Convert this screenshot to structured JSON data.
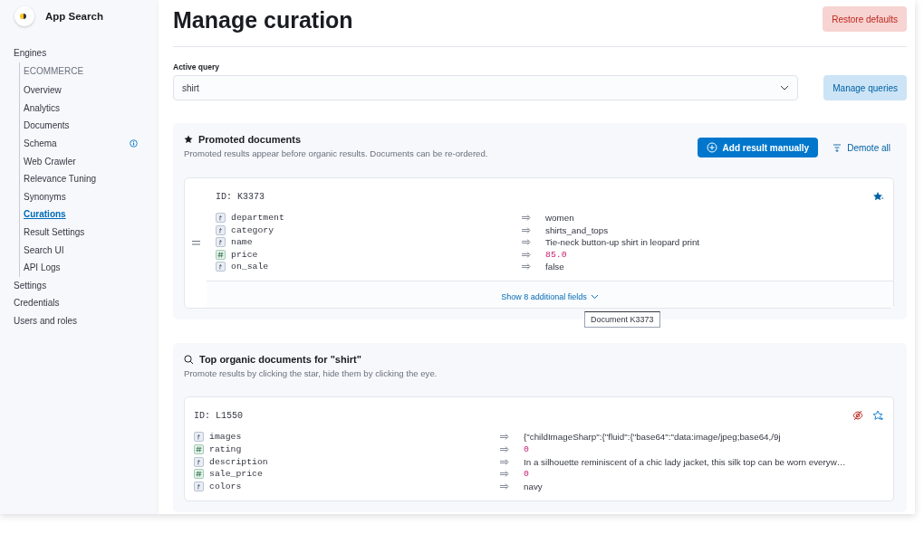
{
  "app": {
    "title": "App Search"
  },
  "sidebar": {
    "items": [
      {
        "label": "Engines",
        "children": [
          {
            "label": "ECOMMERCE",
            "kind": "heading",
            "selected": false,
            "notice": false
          },
          {
            "label": "Overview",
            "kind": "link",
            "selected": false,
            "notice": false
          },
          {
            "label": "Analytics",
            "kind": "link",
            "selected": false,
            "notice": false
          },
          {
            "label": "Documents",
            "kind": "link",
            "selected": false,
            "notice": false
          },
          {
            "label": "Schema",
            "kind": "link",
            "selected": false,
            "notice": true
          },
          {
            "label": "Web Crawler",
            "kind": "link",
            "selected": false,
            "notice": false
          },
          {
            "label": "Relevance Tuning",
            "kind": "link",
            "selected": false,
            "notice": false
          },
          {
            "label": "Synonyms",
            "kind": "link",
            "selected": false,
            "notice": false
          },
          {
            "label": "Curations",
            "kind": "link",
            "selected": true,
            "notice": false
          },
          {
            "label": "Result Settings",
            "kind": "link",
            "selected": false,
            "notice": false
          },
          {
            "label": "Search UI",
            "kind": "link",
            "selected": false,
            "notice": false
          },
          {
            "label": "API Logs",
            "kind": "link",
            "selected": false,
            "notice": false
          }
        ]
      },
      {
        "label": "Settings"
      },
      {
        "label": "Credentials"
      },
      {
        "label": "Users and roles"
      }
    ]
  },
  "page": {
    "title": "Manage curation",
    "restore_button": "Restore defaults"
  },
  "query": {
    "label": "Active query",
    "value": "shirt",
    "manage_button": "Manage queries"
  },
  "promoted": {
    "title": "Promoted documents",
    "description": "Promoted results appear before organic results. Documents can be re-ordered.",
    "add_button": "Add result manually",
    "demote_button": "Demote all",
    "documents": [
      {
        "id": "ID: K3373",
        "promoted": true,
        "fields": [
          {
            "kind": "text",
            "name": "department",
            "value": "women"
          },
          {
            "kind": "text",
            "name": "category",
            "value": "shirts_and_tops"
          },
          {
            "kind": "text",
            "name": "name",
            "value": "Tie-neck button-up shirt in leopard print"
          },
          {
            "kind": "number",
            "name": "price",
            "value": "85.0"
          },
          {
            "kind": "text",
            "name": "on_sale",
            "value": "false"
          }
        ],
        "more": "Show 8 additional fields",
        "tooltip": "Document K3373"
      }
    ]
  },
  "organic": {
    "title": "Top organic documents for \"shirt\"",
    "description": "Promote results by clicking the star, hide them by clicking the eye.",
    "documents": [
      {
        "id": "ID: L1550",
        "promoted": false,
        "fields": [
          {
            "kind": "text",
            "name": "images",
            "value": "{\"childImageSharp\":{\"fluid\":{\"base64\":\"data:image/jpeg;base64,/9j"
          },
          {
            "kind": "number",
            "name": "rating",
            "value": "0"
          },
          {
            "kind": "text",
            "name": "description",
            "value": "In a silhouette reminiscent of a chic lady jacket, this silk top can be worn everyw…"
          },
          {
            "kind": "number",
            "name": "sale_price",
            "value": "0"
          },
          {
            "kind": "text",
            "name": "colors",
            "value": "navy"
          }
        ]
      }
    ]
  }
}
